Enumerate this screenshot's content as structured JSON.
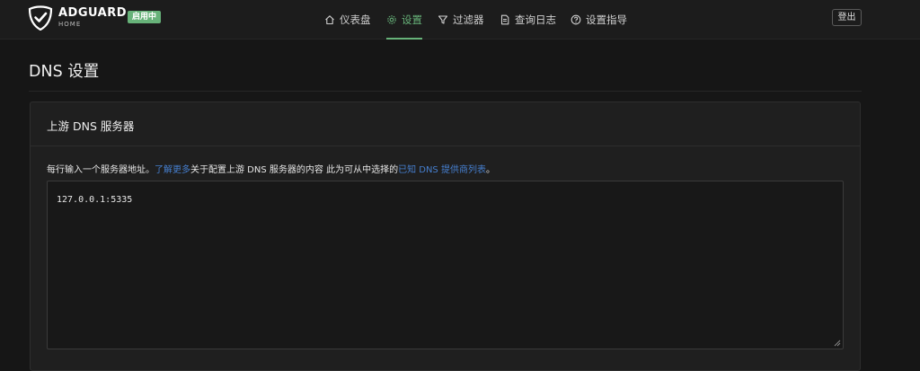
{
  "header": {
    "brand_name": "ADGUARD",
    "brand_sub": "HOME",
    "status_badge": "启用中",
    "nav": [
      {
        "label": "仪表盘",
        "icon": "home-icon"
      },
      {
        "label": "设置",
        "icon": "gear-icon",
        "active": true
      },
      {
        "label": "过滤器",
        "icon": "filter-icon"
      },
      {
        "label": "查询日志",
        "icon": "document-icon"
      },
      {
        "label": "设置指导",
        "icon": "help-circle-icon"
      }
    ],
    "logout_label": "登出"
  },
  "page": {
    "title": "DNS 设置"
  },
  "upstream_card": {
    "title": "上游 DNS 服务器",
    "description_part1": "每行输入一个服务器地址。",
    "learn_more_link": "了解更多",
    "description_part2": "关于配置上游 DNS 服务器的内容 此为可从中选择的",
    "providers_link": "已知 DNS 提供商列表",
    "description_end": "。",
    "textarea_value": "127.0.0.1:5335"
  },
  "colors": {
    "accent": "#67b279",
    "link": "#467fcf",
    "background": "#161616",
    "card": "#1f1f1f"
  }
}
